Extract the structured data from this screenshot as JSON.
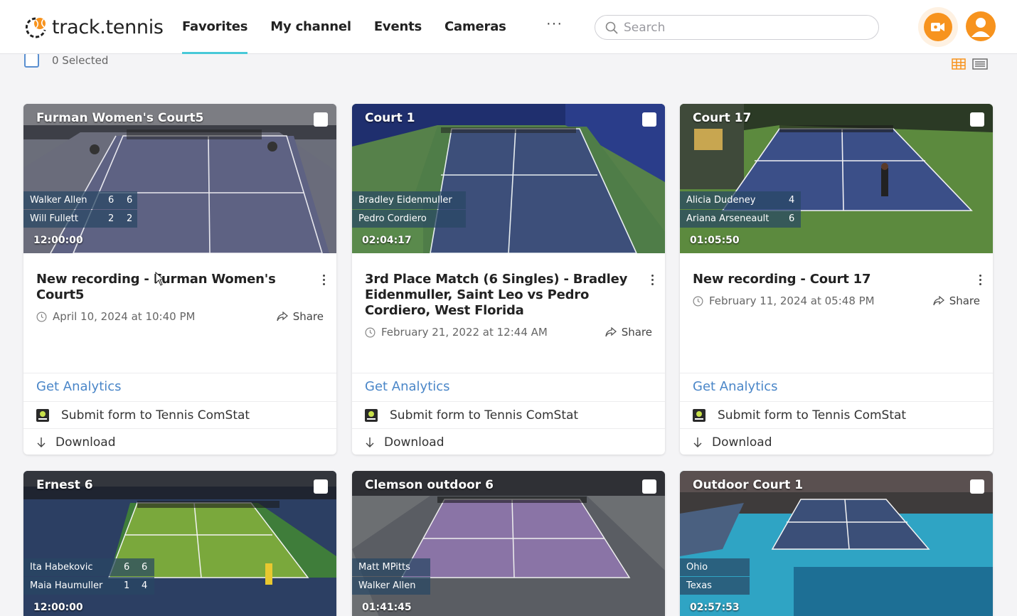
{
  "brand": {
    "name": "track.tennis"
  },
  "nav": {
    "items": [
      "Favorites",
      "My channel",
      "Events",
      "Cameras"
    ],
    "active": "Favorites",
    "more": "···"
  },
  "search": {
    "placeholder": "Search"
  },
  "toolbar": {
    "selected_label": "0 Selected"
  },
  "colors": {
    "accent": "#f7931e",
    "link": "#4a86c8",
    "nav_underline": "#48c9d8"
  },
  "icons": [
    "search-icon",
    "video-camera-icon",
    "user-icon",
    "grid-view-icon",
    "list-view-icon",
    "clock-icon",
    "share-icon",
    "download-icon",
    "comstat-icon"
  ],
  "common": {
    "analytics": "Get Analytics",
    "comstat": "Submit form to Tennis ComStat",
    "download": "Download",
    "share": "Share"
  },
  "cards": [
    {
      "thumb_title": "Furman Women's Court5",
      "players": [
        {
          "name": "Walker Allen",
          "scores": [
            "6",
            "6"
          ]
        },
        {
          "name": "Will Fullett",
          "scores": [
            "2",
            "2"
          ]
        }
      ],
      "duration": "12:00:00",
      "title": "New recording - Furman Women's Court5",
      "date": "April 10, 2024 at 10:40 PM"
    },
    {
      "thumb_title": "Court 1",
      "players": [
        {
          "name": "Bradley Eidenmuller",
          "scores": []
        },
        {
          "name": "Pedro Cordiero",
          "scores": []
        }
      ],
      "duration": "02:04:17",
      "title": "3rd Place Match (6 Singles) - Bradley Eidenmuller, Saint Leo vs Pedro Cordiero, West Florida",
      "date": "February 21, 2022 at 12:44 AM"
    },
    {
      "thumb_title": "Court 17",
      "players": [
        {
          "name": "Alicia Dudeney",
          "scores": [
            "4"
          ]
        },
        {
          "name": "Ariana Arseneault",
          "scores": [
            "6"
          ]
        }
      ],
      "duration": "01:05:50",
      "title": "New recording - Court 17",
      "date": "February 11, 2024 at 05:48 PM"
    },
    {
      "thumb_title": "Ernest 6",
      "players": [
        {
          "name": "Ita Habekovic",
          "scores": [
            "6",
            "6"
          ]
        },
        {
          "name": "Maia Haumuller",
          "scores": [
            "1",
            "4"
          ]
        }
      ],
      "duration": "12:00:00"
    },
    {
      "thumb_title": "Clemson outdoor 6",
      "players": [
        {
          "name": "Matt MPitts",
          "scores": []
        },
        {
          "name": "Walker Allen",
          "scores": []
        }
      ],
      "duration": "01:41:45"
    },
    {
      "thumb_title": "Outdoor Court 1",
      "players": [
        {
          "name": "Ohio",
          "scores": []
        },
        {
          "name": "Texas",
          "scores": []
        }
      ],
      "duration": "02:57:53"
    }
  ]
}
